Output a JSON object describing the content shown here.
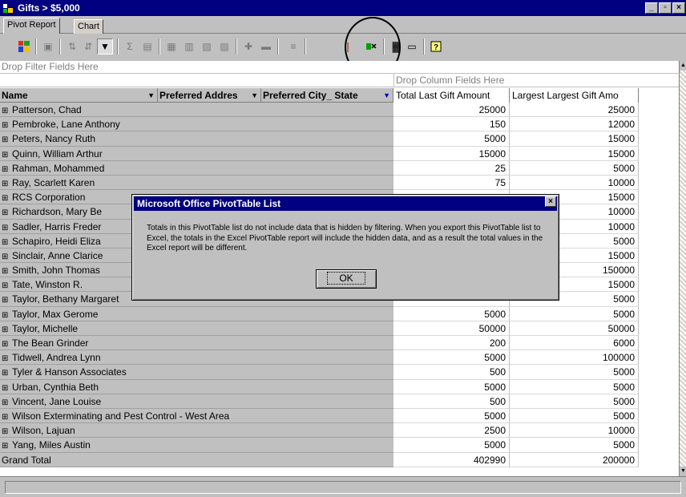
{
  "window": {
    "title": "Gifts > $5,000"
  },
  "tabs": [
    {
      "label": "Pivot Report",
      "active": true
    },
    {
      "label": "Chart",
      "active": false
    }
  ],
  "toolbar": {
    "icons": [
      "office-logo-icon",
      "copy-icon",
      "sort-ascending-icon",
      "sort-descending-icon",
      "autofilter-icon",
      "autosum-icon",
      "subtotal-icon",
      "calculated-total-icon",
      "show-top-bottom-icon",
      "expand-icon",
      "collapse-icon",
      "show-details-icon",
      "hide-details-icon",
      "refresh-icon",
      "export-to-excel-icon",
      "field-list-icon",
      "properties-icon",
      "help-icon"
    ]
  },
  "pivot": {
    "filter_zone": "Drop Filter Fields Here",
    "column_zone": "Drop Column Fields Here",
    "headers": {
      "name": "Name",
      "address": "Preferred Addres",
      "city_state": "Preferred City_ State",
      "total_last_gift": "Total Last Gift Amount",
      "largest_gift": "Largest Largest Gift Amo"
    },
    "rows": [
      {
        "name": "Patterson, Chad",
        "total": "25000",
        "largest": "25000"
      },
      {
        "name": "Pembroke, Lane Anthony",
        "total": "150",
        "largest": "12000"
      },
      {
        "name": "Peters, Nancy Ruth",
        "total": "5000",
        "largest": "15000"
      },
      {
        "name": "Quinn, William Arthur",
        "total": "15000",
        "largest": "15000"
      },
      {
        "name": "Rahman, Mohammed",
        "total": "25",
        "largest": "5000"
      },
      {
        "name": "Ray, Scarlett Karen",
        "total": "75",
        "largest": "10000"
      },
      {
        "name": "RCS Corporation",
        "total": "",
        "largest": "15000"
      },
      {
        "name": "Richardson, Mary Be",
        "total": "",
        "largest": "10000"
      },
      {
        "name": "Sadler, Harris Freder",
        "total": "",
        "largest": "10000"
      },
      {
        "name": "Schapiro, Heidi Eliza",
        "total": "",
        "largest": "5000"
      },
      {
        "name": "Sinclair, Anne Clarice",
        "total": "",
        "largest": "15000"
      },
      {
        "name": "Smith, John Thomas",
        "total": "",
        "largest": "150000"
      },
      {
        "name": "Tate, Winston R.",
        "total": "",
        "largest": "15000"
      },
      {
        "name": "Taylor, Bethany Margaret",
        "total": "",
        "largest": "5000"
      },
      {
        "name": "Taylor, Max Gerome",
        "total": "5000",
        "largest": "5000"
      },
      {
        "name": "Taylor, Michelle",
        "total": "50000",
        "largest": "50000"
      },
      {
        "name": "The Bean Grinder",
        "total": "200",
        "largest": "6000"
      },
      {
        "name": "Tidwell, Andrea Lynn",
        "total": "5000",
        "largest": "100000"
      },
      {
        "name": "Tyler & Hanson Associates",
        "total": "500",
        "largest": "5000"
      },
      {
        "name": "Urban, Cynthia Beth",
        "total": "5000",
        "largest": "5000"
      },
      {
        "name": "Vincent, Jane Louise",
        "total": "500",
        "largest": "5000"
      },
      {
        "name": "Wilson Exterminating and Pest Control - West Area",
        "total": "5000",
        "largest": "5000"
      },
      {
        "name": "Wilson, Lajuan",
        "total": "2500",
        "largest": "10000"
      },
      {
        "name": "Yang, Miles Austin",
        "total": "5000",
        "largest": "5000"
      }
    ],
    "grand_total": {
      "label": "Grand Total",
      "total": "402990",
      "largest": "200000"
    }
  },
  "dialog": {
    "title": "Microsoft Office PivotTable List",
    "message": "Totals in this PivotTable list do not include data that is hidden by filtering. When you export this PivotTable list to Excel, the totals in the Excel PivotTable report will include the hidden data, and as a result the total values in the Excel report will be different.",
    "ok_label": "OK"
  }
}
